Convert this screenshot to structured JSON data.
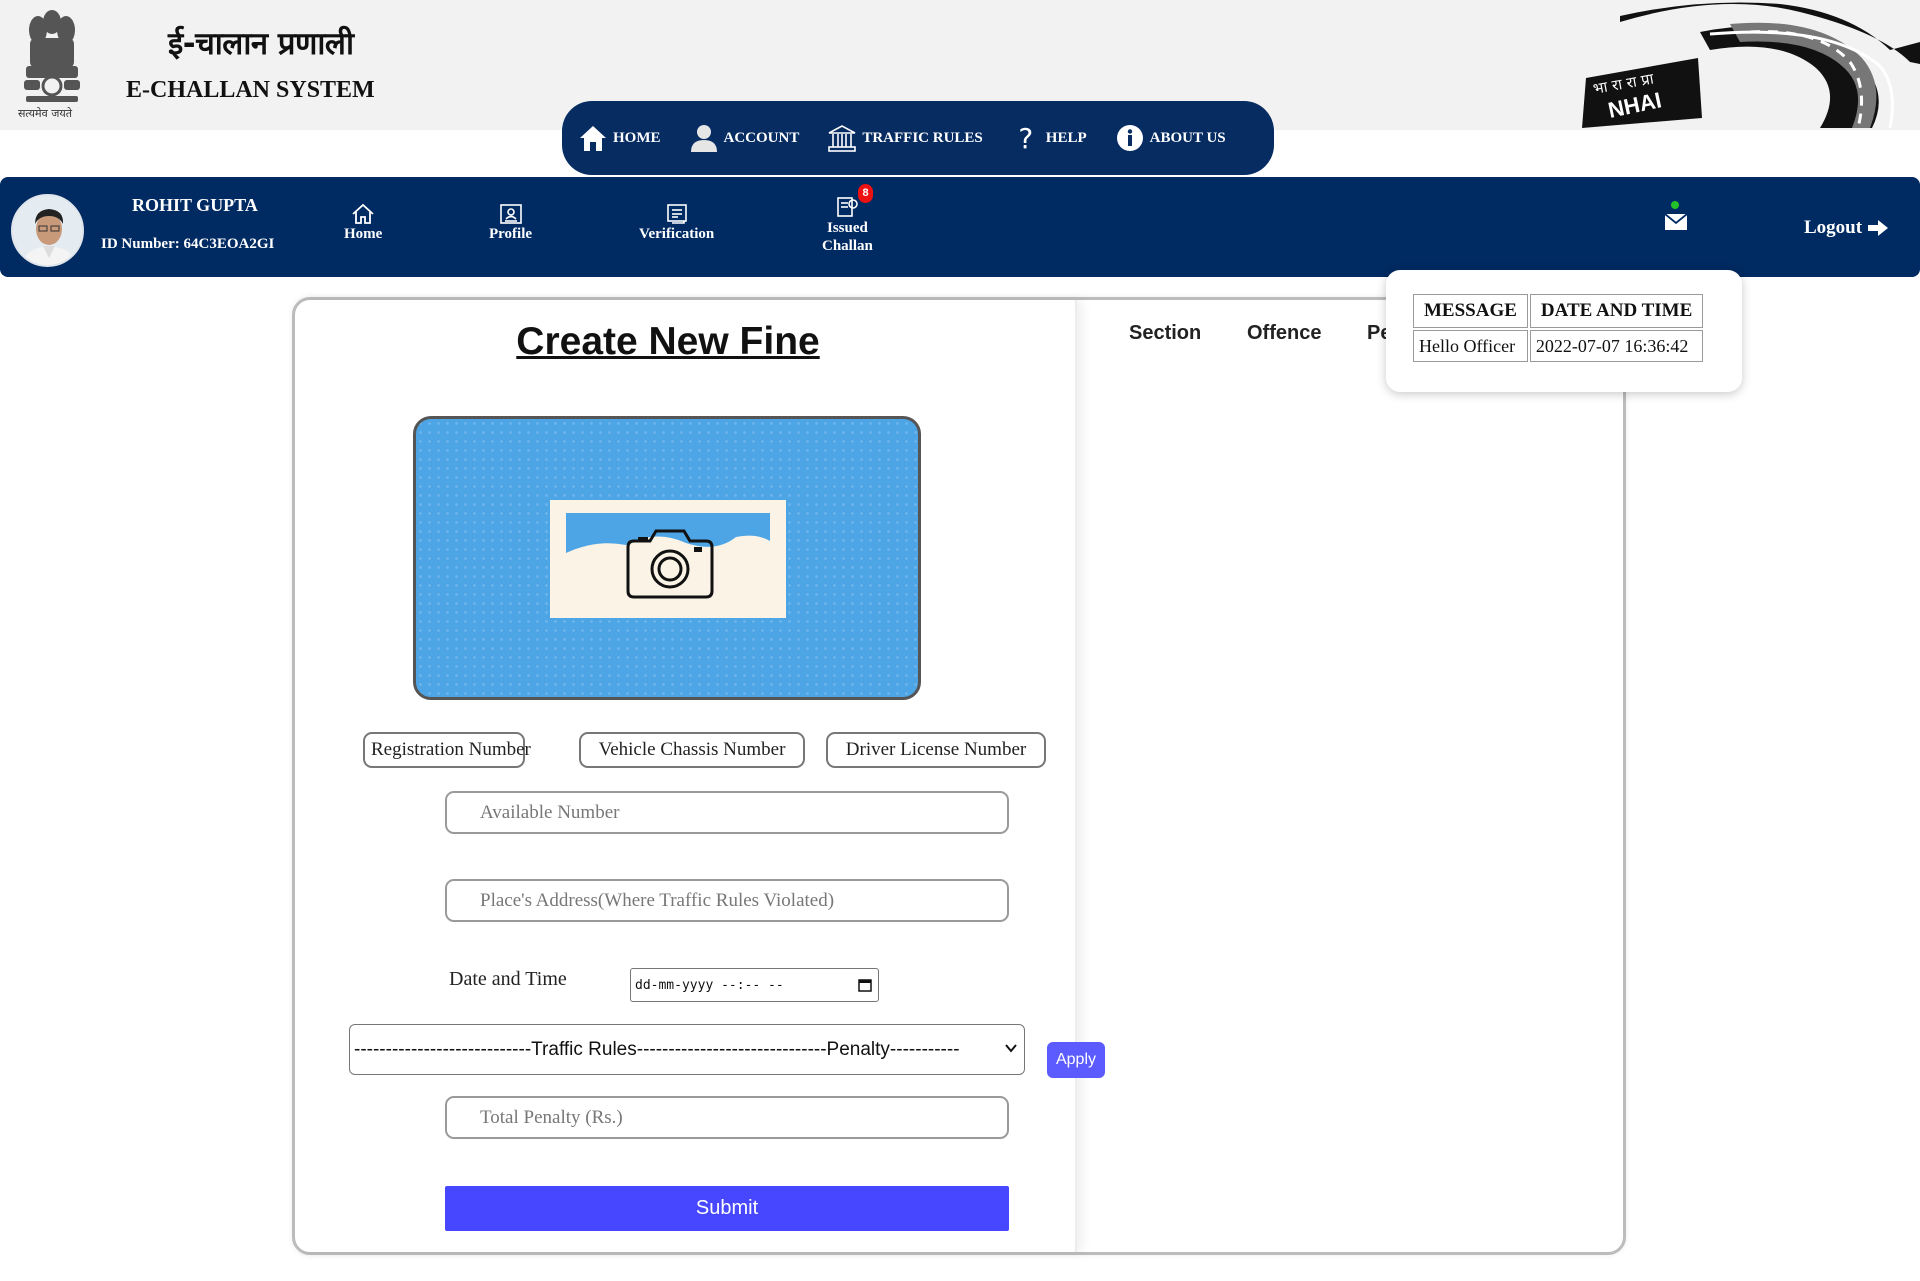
{
  "header": {
    "hindi_title": "ई-चालान प्रणाली",
    "english_title": "E-CHALLAN SYSTEM",
    "emblem_motto": "सत्यमेव जयते",
    "nhai_logo_text": "NHAI",
    "nhai_logo_hindi": "भा रा रा प्रा"
  },
  "top_nav": {
    "items": [
      {
        "label": "HOME",
        "icon": "house-icon"
      },
      {
        "label": "ACCOUNT",
        "icon": "user-icon"
      },
      {
        "label": "TRAFFIC RULES",
        "icon": "building-icon"
      },
      {
        "label": "HELP",
        "icon": "question-icon"
      },
      {
        "label": "ABOUT US",
        "icon": "info-icon"
      }
    ]
  },
  "officer_bar": {
    "name": "ROHIT GUPTA",
    "id_label": "ID Number:",
    "id_value": "64C3EOA2GI",
    "items": [
      {
        "label": "Home",
        "icon": "home-outline-icon"
      },
      {
        "label": "Profile",
        "icon": "id-card-icon"
      },
      {
        "label": "Verification",
        "icon": "document-icon"
      },
      {
        "label_line1": "Issued",
        "label_line2": "Challan",
        "icon": "issued-challan-icon",
        "badge": "8"
      }
    ],
    "logout_label": "Logout",
    "mail_icon": "envelope-icon",
    "online_dot_color": "#22c02a"
  },
  "form": {
    "title": "Create New Fine",
    "search_options": [
      "Registration Number",
      "Vehicle Chassis Number",
      "Driver License Number"
    ],
    "available_number_placeholder": "Available Number",
    "address_placeholder": "Place's Address(Where Traffic Rules Violated)",
    "date_time_label": "Date and Time",
    "date_time_placeholder": "dd-mm-yyyy --:-- --",
    "rules_select_text": "----------------------------Traffic Rules------------------------------Penalty-----------",
    "apply_label": "Apply",
    "total_penalty_placeholder": "Total Penalty (Rs.)",
    "submit_label": "Submit"
  },
  "right_panel": {
    "headers": [
      "Section",
      "Offence",
      "Pe"
    ]
  },
  "messages": {
    "columns": [
      "MESSAGE",
      "DATE AND TIME"
    ],
    "rows": [
      {
        "message": "Hello Officer",
        "datetime": "2022-07-07 16:36:42"
      }
    ]
  },
  "colors": {
    "navy": "#002a62",
    "submit": "#4747ff",
    "apply": "#5b5bff",
    "badge": "#ee1111"
  }
}
